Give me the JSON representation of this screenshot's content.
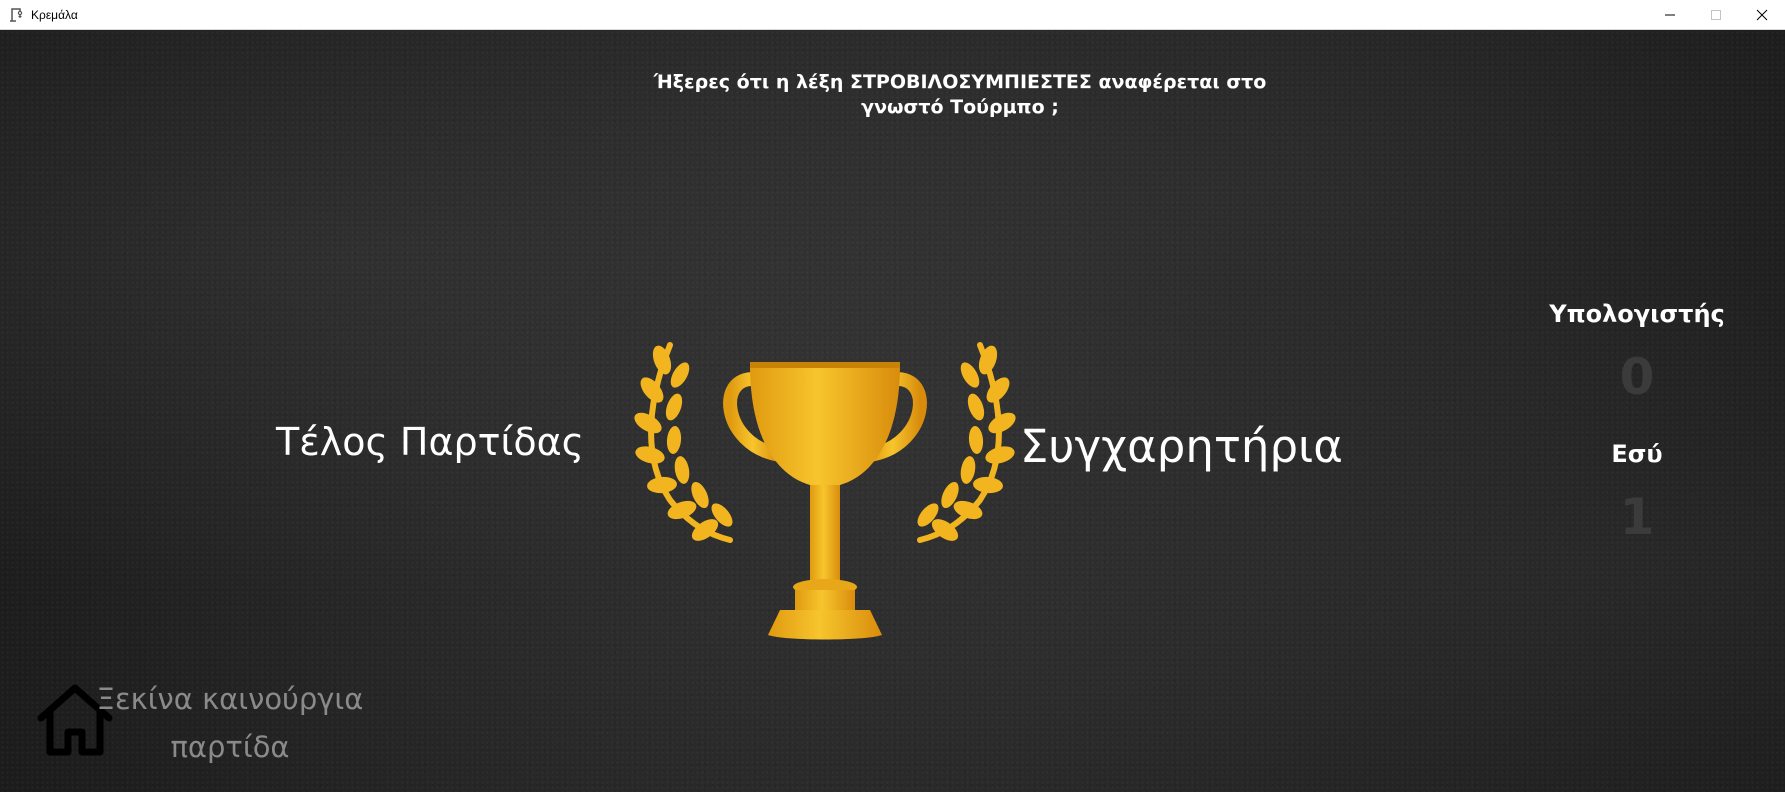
{
  "window": {
    "title": "Κρεμάλα",
    "icon": "hangman-app-icon",
    "controls": [
      "minimize-icon",
      "maximize-icon",
      "close-icon"
    ]
  },
  "fact": {
    "line1": "Ήξερες ότι η λέξη ΣΤΡΟΒΙΛΟΣΥΜΠΙΕΣΤΕΣ αναφέρεται στο",
    "line2": "γνωστό Τούρμπο ;"
  },
  "result": {
    "game_over": "Τέλος Παρτίδας",
    "congrats": "Συγχαρητήρια",
    "image": "trophy-icon"
  },
  "scores": {
    "computer_label": "Υπολογιστής",
    "computer_value": "0",
    "you_label": "Εσύ",
    "you_value": "1"
  },
  "new_game": {
    "icon": "home-icon",
    "line1": "Ξεκίνα καινούργια",
    "line2": "παρτίδα"
  },
  "colors": {
    "background": "#262626",
    "text": "#ffffff",
    "gold": "#f2b51f",
    "muted_text": "#8a8a8a",
    "score_value": "#3b3b3b"
  }
}
